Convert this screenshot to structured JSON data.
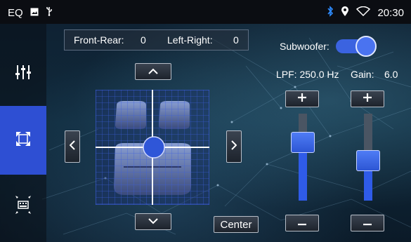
{
  "status_bar": {
    "left_label": "EQ",
    "icons_left": [
      "image-icon",
      "usb-icon"
    ],
    "icons_right": [
      "bluetooth-icon",
      "location-icon",
      "wifi-icon"
    ],
    "time": "20:30"
  },
  "sidebar": {
    "items": [
      {
        "name": "equalizer",
        "icon": "sliders-icon",
        "active": false
      },
      {
        "name": "balance",
        "icon": "focus-expand-icon",
        "active": true
      },
      {
        "name": "speaker-layout",
        "icon": "speaker-grid-icon",
        "active": false
      }
    ]
  },
  "balance": {
    "front_rear_label": "Front-Rear:",
    "front_rear_value": "0",
    "left_right_label": "Left-Right:",
    "left_right_value": "0",
    "center_label": "Center"
  },
  "subwoofer": {
    "label": "Subwoofer:",
    "enabled": true,
    "lpf_text": "LPF: 250.0 Hz",
    "gain_label": "Gain:",
    "gain_value": "6.0",
    "lpf_level": 0.72,
    "gain_level": 0.45
  },
  "colors": {
    "accent": "#2e4fd3",
    "slider_fill": "#2f5be8"
  }
}
